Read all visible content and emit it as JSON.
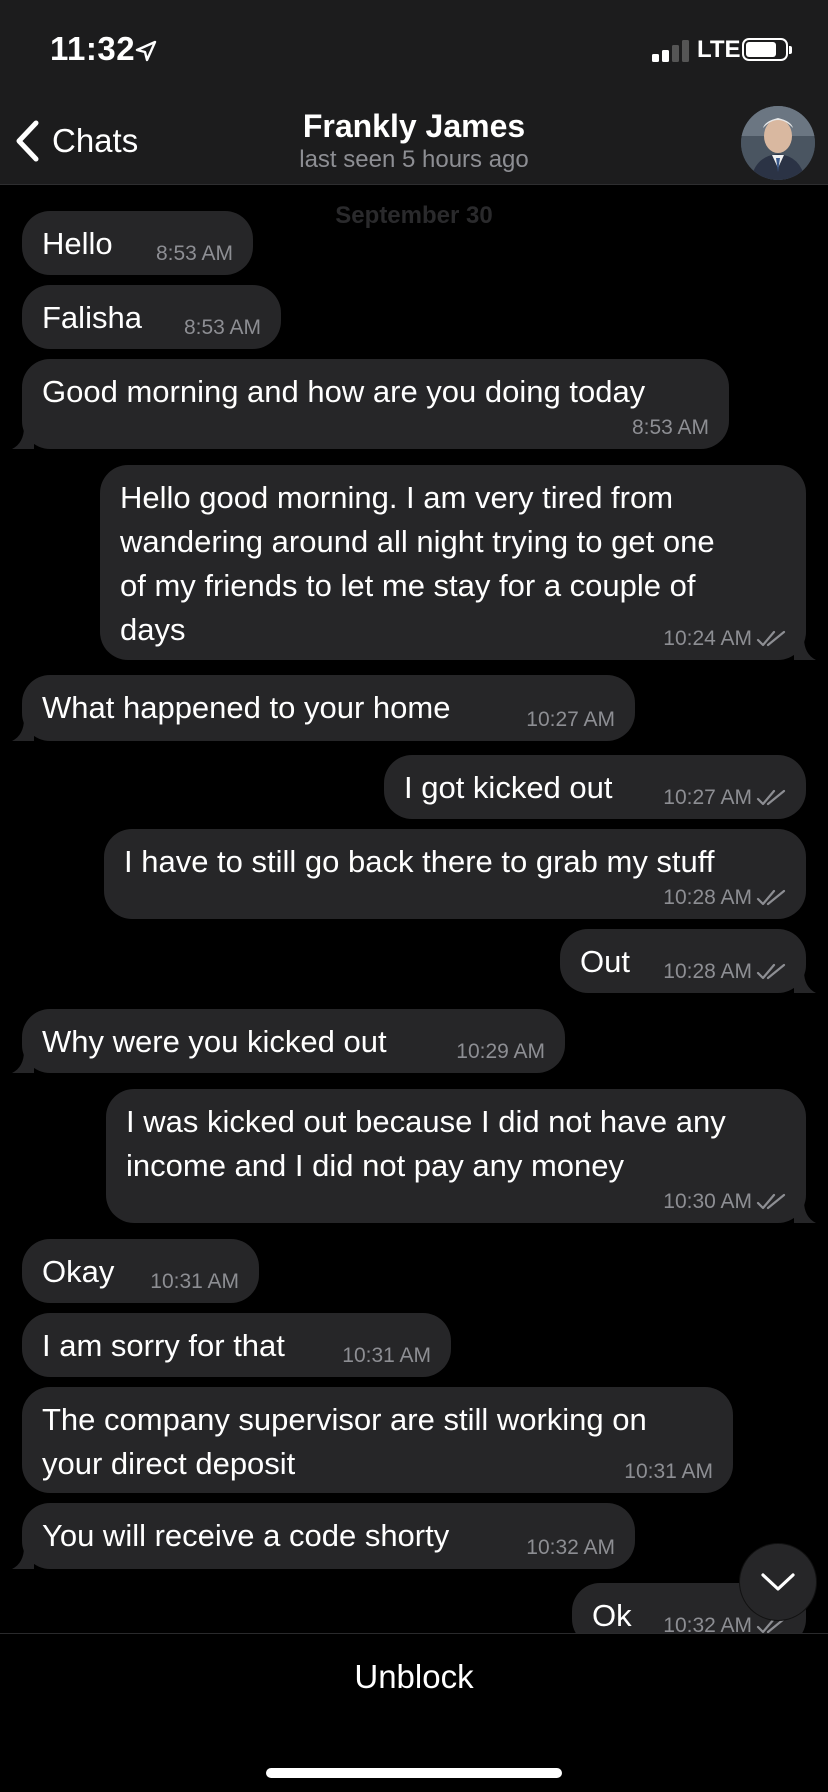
{
  "status_bar": {
    "time": "11:32",
    "network": "LTE"
  },
  "header": {
    "back_label": "Chats",
    "title": "Frankly James",
    "subtitle": "last seen 5 hours ago"
  },
  "date_header": "September 30",
  "messages": [
    {
      "direction": "in",
      "lines": [
        "Hello"
      ],
      "time": "8:53 AM"
    },
    {
      "direction": "in",
      "lines": [
        "Falisha"
      ],
      "time": "8:53 AM"
    },
    {
      "direction": "in",
      "lines": [
        "Good morning and how are you doing today"
      ],
      "time": "8:53 AM"
    },
    {
      "direction": "out",
      "lines": [
        "Hello good morning. I am very tired from",
        "wandering around all night trying to get one",
        "of my friends to let me stay for a couple of",
        "days"
      ],
      "time": "10:24 AM",
      "read": true
    },
    {
      "direction": "in",
      "lines": [
        "What happened to your home"
      ],
      "time": "10:27 AM"
    },
    {
      "direction": "out",
      "lines": [
        "I got kicked out"
      ],
      "time": "10:27 AM",
      "read": true
    },
    {
      "direction": "out",
      "lines": [
        "I have to still go back there to grab my stuff"
      ],
      "time": "10:28 AM",
      "read": true
    },
    {
      "direction": "out",
      "lines": [
        "Out"
      ],
      "time": "10:28 AM",
      "read": true
    },
    {
      "direction": "in",
      "lines": [
        "Why were you kicked out"
      ],
      "time": "10:29 AM"
    },
    {
      "direction": "out",
      "lines": [
        "I was kicked out because I did not have any",
        "income and I did not pay any money"
      ],
      "time": "10:30 AM",
      "read": true
    },
    {
      "direction": "in",
      "lines": [
        "Okay"
      ],
      "time": "10:31 AM"
    },
    {
      "direction": "in",
      "lines": [
        "I am sorry for that"
      ],
      "time": "10:31 AM"
    },
    {
      "direction": "in",
      "lines": [
        "The company supervisor are still working on",
        "your direct deposit"
      ],
      "time": "10:31 AM"
    },
    {
      "direction": "in",
      "lines": [
        "You will receive a code shorty"
      ],
      "time": "10:32 AM"
    },
    {
      "direction": "out",
      "lines": [
        "Ok"
      ],
      "time": "10:32 AM",
      "read": true
    }
  ],
  "footer": {
    "unblock_label": "Unblock"
  },
  "colors": {
    "bubble": "#262628",
    "background": "#000000",
    "meta": "#8d8e93"
  },
  "icons": [
    "location-arrow-icon",
    "signal-icon",
    "battery-icon",
    "chevron-left-icon",
    "read-checkmarks-icon",
    "chevron-down-icon"
  ]
}
